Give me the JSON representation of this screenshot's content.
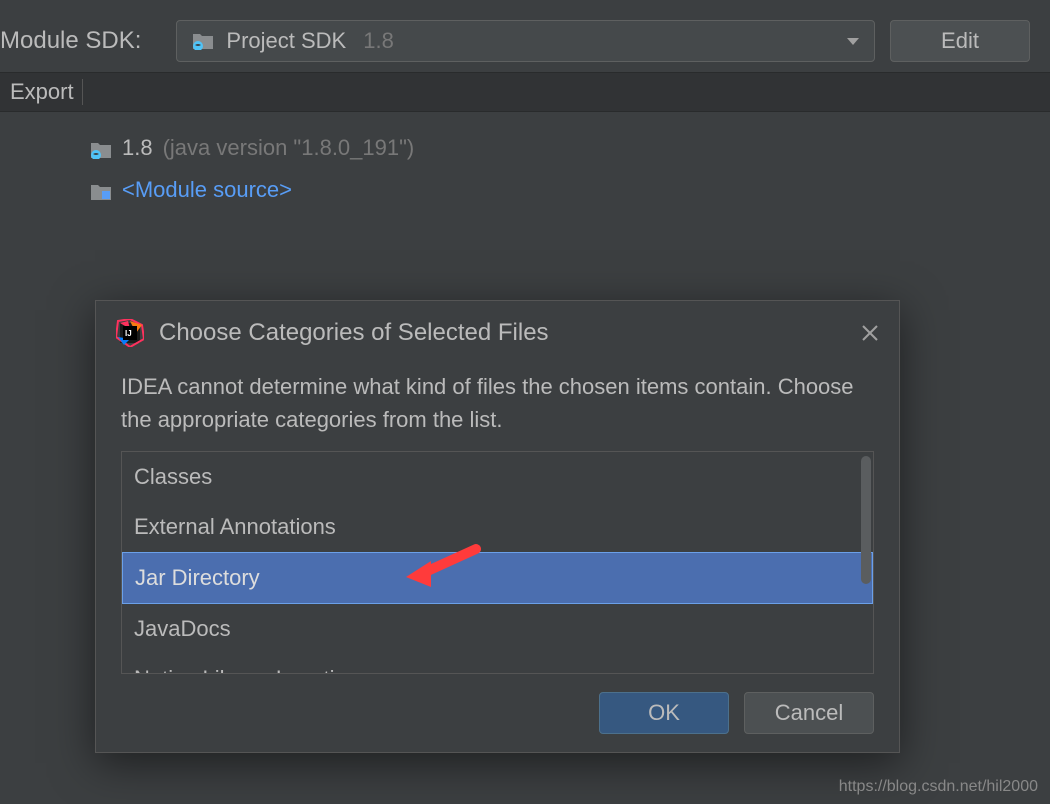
{
  "sdk": {
    "label": "Module SDK:",
    "selected": "Project SDK",
    "version": "1.8",
    "editButton": "Edit"
  },
  "export": {
    "label": "Export"
  },
  "entries": {
    "jdk": {
      "label": "1.8",
      "detail": "(java version \"1.8.0_191\")"
    },
    "moduleSource": {
      "label": "<Module source>"
    }
  },
  "dialog": {
    "title": "Choose Categories of Selected Files",
    "message": "IDEA cannot determine what kind of files the chosen items contain. Choose the appropriate categories from the list.",
    "categories": {
      "classes": "Classes",
      "externalAnnotations": "External Annotations",
      "jarDirectory": "Jar Directory",
      "javaDocs": "JavaDocs",
      "nativeLibraryLocation": "Native Library Location"
    },
    "okButton": "OK",
    "cancelButton": "Cancel"
  },
  "watermark": "https://blog.csdn.net/hil2000"
}
